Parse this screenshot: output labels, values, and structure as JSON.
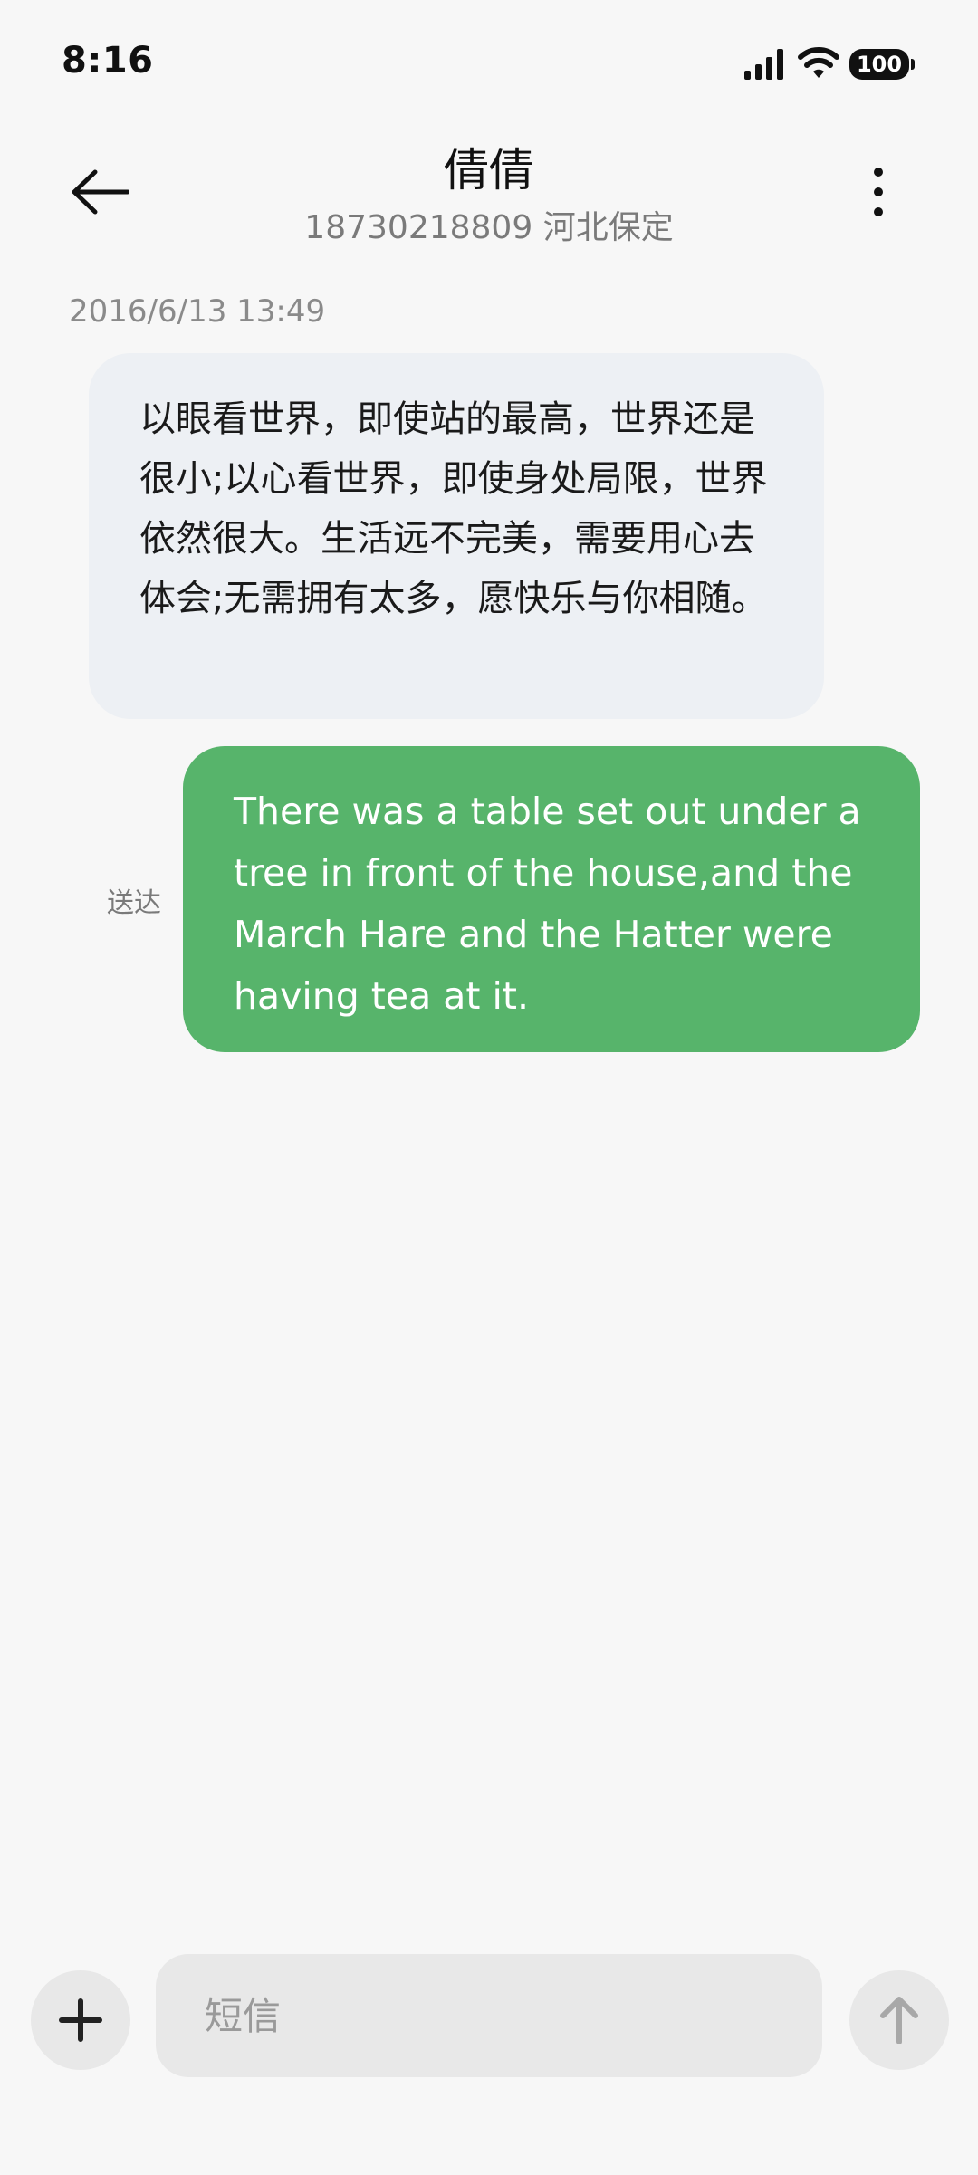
{
  "status_bar": {
    "time": "8:16",
    "battery": "100",
    "icons": [
      "signal-icon",
      "wifi-icon",
      "battery-icon"
    ]
  },
  "header": {
    "contact_name": "倩倩",
    "contact_subtitle": "18730218809 河北保定",
    "icons": [
      "back-arrow-icon",
      "more-vertical-icon"
    ]
  },
  "messages": {
    "timestamp": "2016/6/13 13:49",
    "incoming_text": "以眼看世界，即使站的最高，世界还是很小;以心看世界，即使身处局限，世界依然很大。生活远不完美，需要用心去体会;无需拥有太多，愿快乐与你相随。",
    "outgoing_text": "There was a table set out under a tree in front of the house,and the March Hare and the Hatter were having tea at it.",
    "outgoing_status": "送达"
  },
  "input_bar": {
    "placeholder": "短信",
    "value": "",
    "icons": [
      "plus-icon",
      "send-arrow-icon"
    ]
  },
  "colors": {
    "background": "#f7f7f7",
    "incoming_bubble": "#edf0f4",
    "outgoing_bubble": "#57b46b",
    "input_bg": "#e8e8e8"
  }
}
